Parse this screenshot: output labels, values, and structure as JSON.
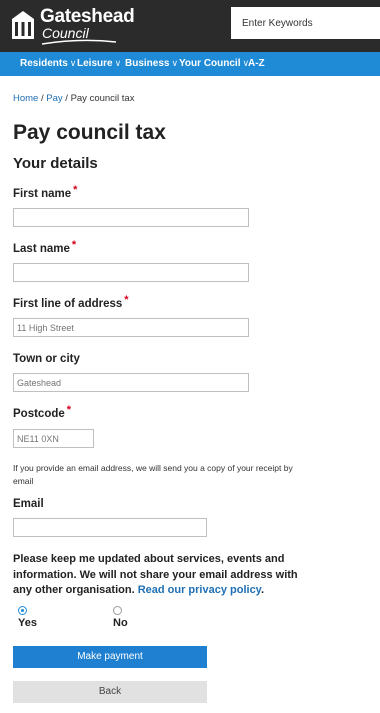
{
  "header": {
    "logo_line1": "Gateshead",
    "logo_line2": "Council",
    "search_placeholder": "Enter Keywords"
  },
  "nav": {
    "items": [
      {
        "label": "Residents"
      },
      {
        "label": "Leisure"
      },
      {
        "label": "Business"
      },
      {
        "label": "Your Council"
      },
      {
        "label": "A-Z"
      }
    ],
    "chevron": "∨"
  },
  "breadcrumb": {
    "home": "Home",
    "sep": " / ",
    "pay": "Pay",
    "current": "Pay council tax"
  },
  "page_title": "Pay council tax",
  "section_title": "Your details",
  "form": {
    "required_marker": "*",
    "first_name": {
      "label": "First name",
      "value": ""
    },
    "last_name": {
      "label": "Last name",
      "value": ""
    },
    "address_line1": {
      "label": "First line of address",
      "placeholder": "11 High Street"
    },
    "town": {
      "label": "Town or city",
      "placeholder": "Gateshead"
    },
    "postcode": {
      "label": "Postcode",
      "placeholder": "NE11 0XN"
    },
    "email_note": "If you provide an email address, we will send you a copy of your receipt by email",
    "email": {
      "label": "Email",
      "value": ""
    },
    "consent_text": "Please keep me updated about services, events and information. We will not share your email address with any other organisation.",
    "consent_link": "Read our privacy policy",
    "consent_end": ".",
    "radio_yes": "Yes",
    "radio_no": "No",
    "selected": "Yes"
  },
  "buttons": {
    "primary": "Make payment",
    "secondary": "Back"
  },
  "colors": {
    "header_bg": "#2b2b2b",
    "nav_bg": "#1f8ad6",
    "link": "#1f6fb4",
    "required": "#d4001a",
    "primary_button": "#1f7fd1",
    "secondary_button": "#e1e1e1"
  }
}
